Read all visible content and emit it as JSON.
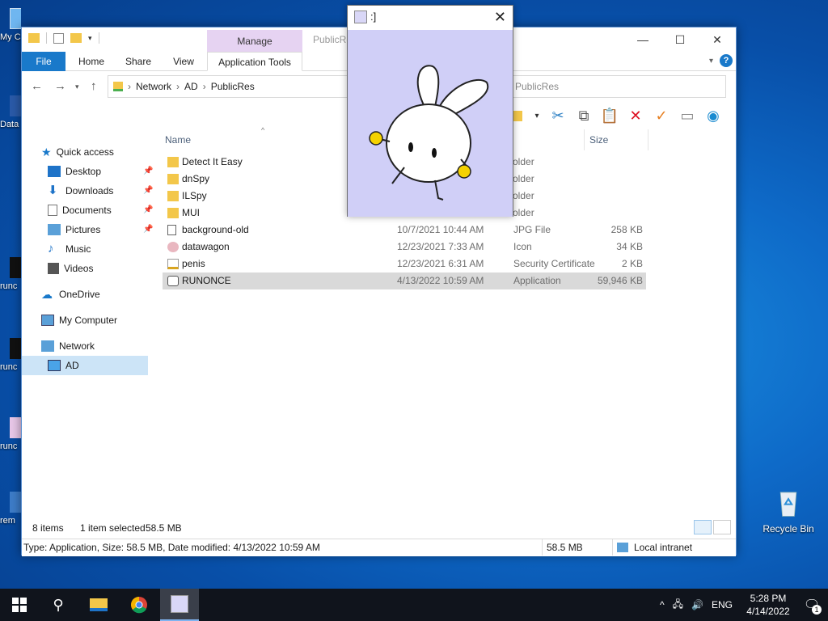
{
  "desktop": {
    "left_labels": [
      "My C",
      "Data",
      "runc",
      "runc",
      "runc",
      "rem"
    ],
    "recycle_bin": "Recycle Bin"
  },
  "explorer": {
    "title": "PublicRes",
    "manage_label": "Manage",
    "tabs": [
      "File",
      "Home",
      "Share",
      "View"
    ],
    "app_tools_label": "Application Tools",
    "address": [
      "Network",
      "AD",
      "PublicRes"
    ],
    "search_text": "PublicRes",
    "nav": {
      "quick_access": "Quick access",
      "items": [
        {
          "label": "Desktop",
          "pinned": true
        },
        {
          "label": "Downloads",
          "pinned": true
        },
        {
          "label": "Documents",
          "pinned": true
        },
        {
          "label": "Pictures",
          "pinned": true
        },
        {
          "label": "Music",
          "pinned": false
        },
        {
          "label": "Videos",
          "pinned": false
        }
      ],
      "onedrive": "OneDrive",
      "my_computer": "My Computer",
      "network": "Network",
      "ad": "AD"
    },
    "columns": {
      "name": "Name",
      "size": "Size"
    },
    "files": [
      {
        "name": "Detect It Easy",
        "date": "",
        "type": "older",
        "size": "",
        "kind": "folder"
      },
      {
        "name": "dnSpy",
        "date": "",
        "type": "older",
        "size": "",
        "kind": "folder"
      },
      {
        "name": "ILSpy",
        "date": "",
        "type": "older",
        "size": "",
        "kind": "folder"
      },
      {
        "name": "MUI",
        "date": "",
        "type": "older",
        "size": "",
        "kind": "folder"
      },
      {
        "name": "background-old",
        "date": "10/7/2021 10:44 AM",
        "type": "JPG File",
        "size": "258 KB",
        "kind": "image"
      },
      {
        "name": "datawagon",
        "date": "12/23/2021 7:33 AM",
        "type": "Icon",
        "size": "34 KB",
        "kind": "icon"
      },
      {
        "name": "penis",
        "date": "12/23/2021 6:31 AM",
        "type": "Security Certificate",
        "size": "2 KB",
        "kind": "cert"
      },
      {
        "name": "RUNONCE",
        "date": "4/13/2022 10:59 AM",
        "type": "Application",
        "size": "59,946 KB",
        "kind": "app"
      }
    ],
    "status": {
      "items": "8 items",
      "selected": "1 item selected",
      "size": "58.5 MB"
    },
    "details": {
      "text": "Type: Application, Size: 58.5 MB, Date modified: 4/13/2022 10:59 AM",
      "size": "58.5 MB",
      "zone": "Local intranet"
    }
  },
  "popup": {
    "title": ":]"
  },
  "taskbar": {
    "lang": "ENG",
    "time": "5:28 PM",
    "date": "4/14/2022",
    "notif_count": "1"
  },
  "colors": {
    "accent": "#1979ca",
    "manage": "#e6d3f2",
    "popup_bg": "#d0cff7"
  }
}
